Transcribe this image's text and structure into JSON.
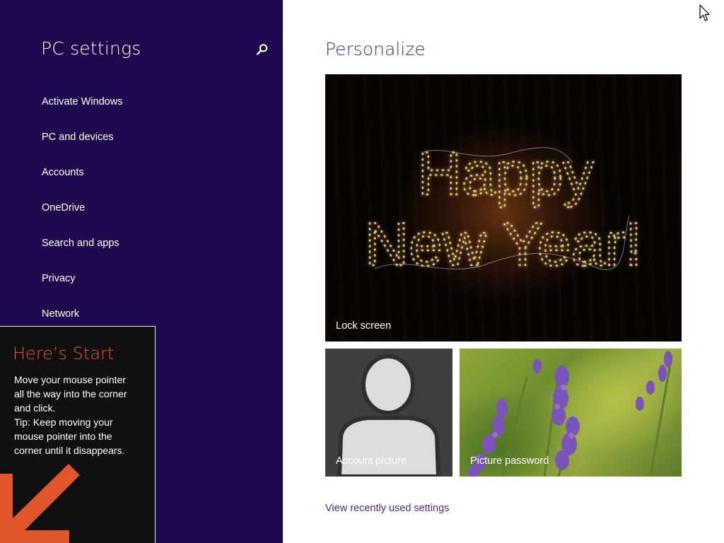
{
  "sidebar": {
    "title": "PC settings",
    "search_icon": "search-icon",
    "items": [
      {
        "label": "Activate Windows"
      },
      {
        "label": "PC and devices"
      },
      {
        "label": "Accounts"
      },
      {
        "label": "OneDrive"
      },
      {
        "label": "Search and apps"
      },
      {
        "label": "Privacy"
      },
      {
        "label": "Network"
      }
    ]
  },
  "main": {
    "title": "Personalize",
    "tiles": {
      "lock_screen": {
        "label": "Lock screen",
        "image_text": [
          "Happy",
          "New Year!"
        ]
      },
      "account_picture": {
        "label": "Account picture"
      },
      "picture_password": {
        "label": "Picture password"
      }
    },
    "link": "View recently used settings"
  },
  "start_tip": {
    "title": "Here’s Start",
    "line1": "Move your mouse pointer",
    "line2": "all the way into the corner",
    "line3": "and click.",
    "line4": "Tip: Keep moving your",
    "line5": "mouse pointer into the",
    "line6": "corner until it disappears."
  },
  "colors": {
    "sidebar_bg": "#1f0a50",
    "accent": "#4d2a9c",
    "tip_title": "#e8582e",
    "tip_arrow": "#e0552a"
  }
}
